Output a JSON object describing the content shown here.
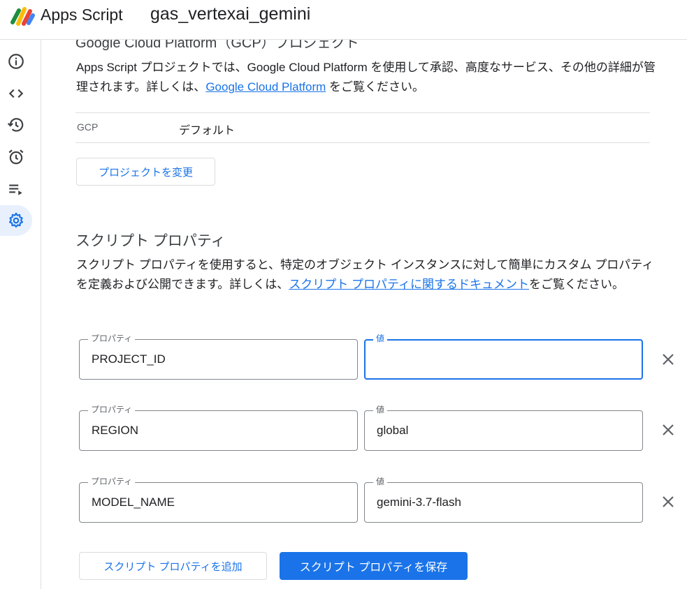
{
  "header": {
    "app_name": "Apps Script",
    "project_name": "gas_vertexai_gemini"
  },
  "sidebar": {
    "items": [
      {
        "icon": "info-icon",
        "label": "Overview"
      },
      {
        "icon": "code-icon",
        "label": "Editor"
      },
      {
        "icon": "history-icon",
        "label": "Executions"
      },
      {
        "icon": "alarm-icon",
        "label": "Triggers"
      },
      {
        "icon": "playlist-play-icon",
        "label": "Executions list"
      },
      {
        "icon": "gear-icon",
        "label": "Project settings",
        "active": true
      }
    ]
  },
  "gcp": {
    "heading": "Google Cloud Platform（GCP）プロジェクト",
    "desc_before": "Apps Script プロジェクトでは、Google Cloud Platform を使用して承認、高度なサービス、その他の詳細が管理されます。詳しくは、",
    "desc_link": "Google Cloud Platform",
    "desc_after": " をご覧ください。",
    "key": "GCP",
    "value": "デフォルト",
    "change_button": "プロジェクトを変更"
  },
  "script_properties": {
    "heading": "スクリプト プロパティ",
    "desc_before": "スクリプト プロパティを使用すると、特定のオブジェクト インスタンスに対して簡単にカスタム プロパティを定義および公開できます。詳しくは、",
    "desc_link": "スクリプト プロパティに関するドキュメント",
    "desc_after": "をご覧ください。",
    "property_label": "プロパティ",
    "value_label": "値",
    "rows": [
      {
        "property": "PROJECT_ID",
        "value": ""
      },
      {
        "property": "REGION",
        "value": "global"
      },
      {
        "property": "MODEL_NAME",
        "value": "gemini-3.7-flash"
      }
    ],
    "add_button": "スクリプト プロパティを追加",
    "save_button": "スクリプト プロパティを保存"
  },
  "colors": {
    "accent": "#1a73e8",
    "border": "#dadce0",
    "active_bg": "#e8f0fe"
  }
}
